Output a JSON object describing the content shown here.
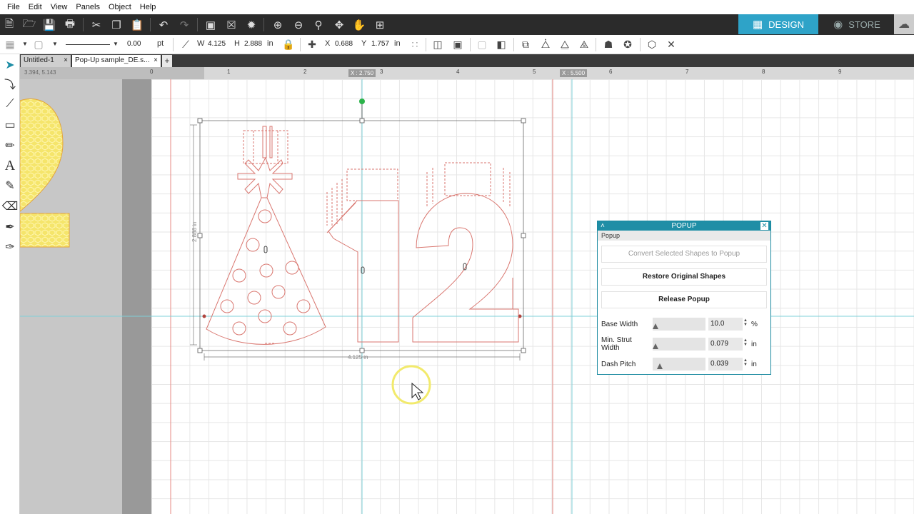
{
  "menu": [
    "File",
    "Edit",
    "View",
    "Panels",
    "Object",
    "Help"
  ],
  "mode_tabs": {
    "design": "DESIGN",
    "store": "STORE"
  },
  "toolbar2": {
    "line_weight": "0.00",
    "line_unit": "pt",
    "w_label": "W",
    "w_value": "4.125",
    "h_label": "H",
    "h_value": "2.888",
    "size_unit": "in",
    "x_label": "X",
    "x_value": "0.688",
    "y_label": "Y",
    "y_value": "1.757",
    "pos_unit": "in"
  },
  "doc_tabs": [
    {
      "label": "Untitled-1",
      "close": "×"
    },
    {
      "label": "Pop-Up sample_DE.s...",
      "close": "×"
    }
  ],
  "add_tab": "+",
  "ruler": {
    "coords": "3.394, 5.143",
    "ticks": [
      "0",
      "1",
      "2",
      "3",
      "4",
      "5",
      "6",
      "7",
      "8",
      "9"
    ],
    "marker_x1": "X : 2.750",
    "marker_x2": "X : 5.500"
  },
  "dimensions": {
    "height_label": "2.888 in",
    "width_label": "4.125 in"
  },
  "popup_panel": {
    "title": "POPUP",
    "subtitle": "Popup",
    "btn_convert": "Convert Selected Shapes to Popup",
    "btn_restore": "Restore Original Shapes",
    "btn_release": "Release Popup",
    "base_width_label": "Base Width",
    "base_width_value": "10.0",
    "base_width_unit": "%",
    "min_strut_label": "Min. Strut Width",
    "min_strut_value": "0.079",
    "min_strut_unit": "in",
    "dash_pitch_label": "Dash Pitch",
    "dash_pitch_value": "0.039",
    "dash_pitch_unit": "in"
  },
  "colors": {
    "accent": "#2ea3c8",
    "cut_line": "#d9766f",
    "guide_line": "#7fd0d8",
    "handle_green": "#2bb34a"
  },
  "icons": [
    "select-arrow-icon",
    "text-icon",
    "eraser-icon",
    "knife-icon",
    "eyedropper-icon",
    "zoom-in-icon",
    "zoom-out-icon",
    "pan-hand-icon",
    "undo-icon",
    "redo-icon"
  ]
}
